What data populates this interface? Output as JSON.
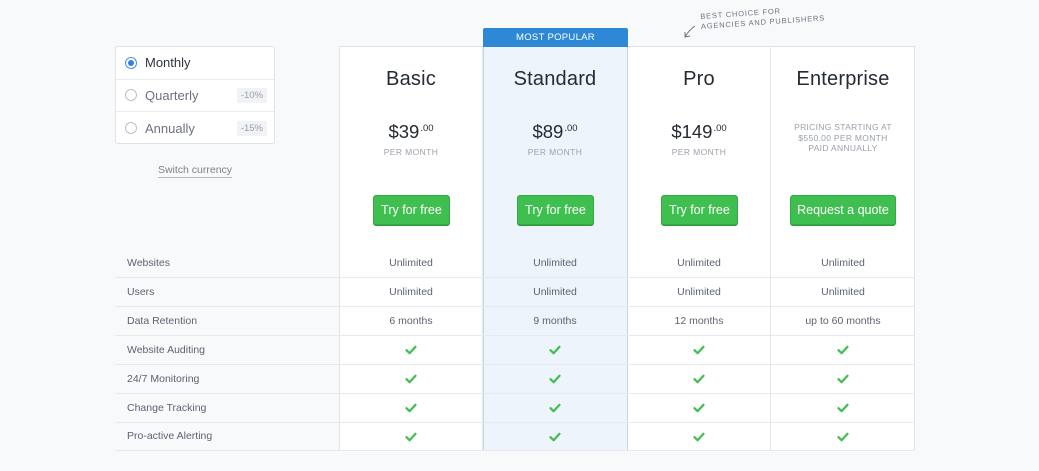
{
  "billing": {
    "options": [
      {
        "label": "Monthly",
        "discount": "",
        "selected": true
      },
      {
        "label": "Quarterly",
        "discount": "-10%",
        "selected": false
      },
      {
        "label": "Annually",
        "discount": "-15%",
        "selected": false
      }
    ],
    "switch_currency": "Switch currency"
  },
  "annotation": "Best choice for agencies and publishers",
  "popular_badge": "MOST POPULAR",
  "plans": [
    {
      "name": "Basic",
      "price": "$39",
      "cents": ".00",
      "period": "PER MONTH",
      "cta": "Try for free"
    },
    {
      "name": "Standard",
      "price": "$89",
      "cents": ".00",
      "period": "PER MONTH",
      "cta": "Try for free"
    },
    {
      "name": "Pro",
      "price": "$149",
      "cents": ".00",
      "period": "PER MONTH",
      "cta": "Try for free"
    },
    {
      "name": "Enterprise",
      "note": "PRICING STARTING AT $550.00 PER MONTH PAID ANNUALLY",
      "cta": "Request a quote"
    }
  ],
  "features": [
    {
      "label": "Websites",
      "values": [
        "Unlimited",
        "Unlimited",
        "Unlimited",
        "Unlimited"
      ]
    },
    {
      "label": "Users",
      "values": [
        "Unlimited",
        "Unlimited",
        "Unlimited",
        "Unlimited"
      ]
    },
    {
      "label": "Data Retention",
      "values": [
        "6 months",
        "9 months",
        "12 months",
        "up to 60 months"
      ]
    },
    {
      "label": "Website Auditing",
      "values": [
        "check-icon",
        "check-icon",
        "check-icon",
        "check-icon"
      ]
    },
    {
      "label": "24/7 Monitoring",
      "values": [
        "check-icon",
        "check-icon",
        "check-icon",
        "check-icon"
      ]
    },
    {
      "label": "Change Tracking",
      "values": [
        "check-icon",
        "check-icon",
        "check-icon",
        "check-icon"
      ]
    },
    {
      "label": "Pro-active Alerting",
      "values": [
        "check-icon",
        "check-icon",
        "check-icon",
        "check-icon"
      ]
    }
  ],
  "colors": {
    "accent_blue": "#2d88d6",
    "cta_green": "#3fbf4f",
    "check_green": "#3fbf4f",
    "highlight_bg": "#eef4fb"
  }
}
